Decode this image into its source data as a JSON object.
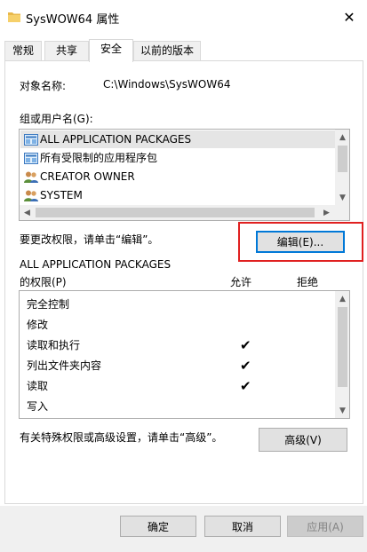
{
  "window": {
    "title": "SysWOW64 属性",
    "close_glyph": "✕"
  },
  "tabs": [
    {
      "label": "常规",
      "active": false
    },
    {
      "label": "共享",
      "active": false
    },
    {
      "label": "安全",
      "active": true
    },
    {
      "label": "以前的版本",
      "active": false
    }
  ],
  "object": {
    "label": "对象名称:",
    "value": "C:\\Windows\\SysWOW64"
  },
  "groups": {
    "label": "组或用户名(G):",
    "items": [
      {
        "name": "ALL APPLICATION PACKAGES",
        "icon": "app-package-icon",
        "selected": true
      },
      {
        "name": "所有受限制的应用程序包",
        "icon": "app-package-icon",
        "selected": false
      },
      {
        "name": "CREATOR OWNER",
        "icon": "users-icon",
        "selected": false
      },
      {
        "name": "SYSTEM",
        "icon": "users-icon",
        "selected": false
      }
    ]
  },
  "edit": {
    "hint": "要更改权限，请单击“编辑”。",
    "button": "编辑(E)..."
  },
  "permissions": {
    "principal": "ALL APPLICATION PACKAGES",
    "label": "的权限(P)",
    "allow_header": "允许",
    "deny_header": "拒绝",
    "rows": [
      {
        "name": "完全控制",
        "allow": ""
      },
      {
        "name": "修改",
        "allow": ""
      },
      {
        "name": "读取和执行",
        "allow": "✔"
      },
      {
        "name": "列出文件夹内容",
        "allow": "✔"
      },
      {
        "name": "读取",
        "allow": "✔"
      },
      {
        "name": "写入",
        "allow": ""
      }
    ]
  },
  "advanced": {
    "hint": "有关特殊权限或高级设置，请单击“高级”。",
    "button": "高级(V)"
  },
  "footer": {
    "ok": "确定",
    "cancel": "取消",
    "apply": "应用(A)"
  },
  "colors": {
    "highlight": "#e02020",
    "accent": "#0078d7"
  }
}
